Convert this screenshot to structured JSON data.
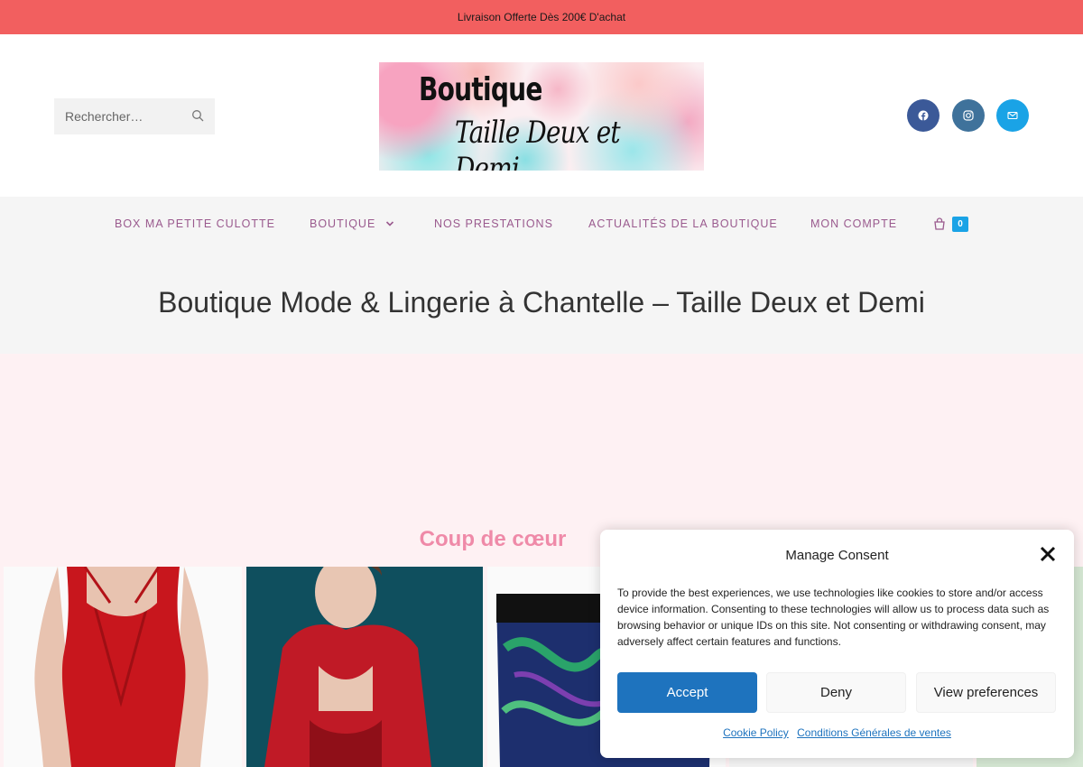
{
  "topbar": {
    "text": "Livraison Offerte Dès 200€ D'achat"
  },
  "search": {
    "placeholder": "Rechercher…"
  },
  "logo": {
    "line1": "Boutique",
    "line2": "Taille Deux et Demi"
  },
  "social": [
    {
      "name": "facebook",
      "color": "#3b5998"
    },
    {
      "name": "instagram",
      "color": "#3f729b"
    },
    {
      "name": "email",
      "color": "#1aa3e6"
    }
  ],
  "nav": {
    "items": [
      "BOX MA PETITE CULOTTE",
      "BOUTIQUE",
      "NOS PRESTATIONS",
      "ACTUALITÉS DE LA BOUTIQUE",
      "MON COMPTE"
    ],
    "cart_count": "0"
  },
  "page": {
    "title": "Boutique Mode & Lingerie à Chantelle – Taille Deux et Demi"
  },
  "section": {
    "title": "Coup de cœur"
  },
  "consent": {
    "title": "Manage Consent",
    "text": "To provide the best experiences, we use technologies like cookies to store and/or access device information. Consenting to these technologies will allow us to process data such as browsing behavior or unique IDs on this site. Not consenting or withdrawing consent, may adversely affect certain features and functions.",
    "accept": "Accept",
    "deny": "Deny",
    "preferences": "View preferences",
    "cookie_policy": "Cookie Policy",
    "terms": "Conditions Générales de ventes"
  },
  "colors": {
    "topbar": "#f25f5f",
    "nav_text": "#9a5a8e",
    "section_title": "#ef8aa8",
    "accept": "#1e73be",
    "badge": "#1aa3e6"
  }
}
